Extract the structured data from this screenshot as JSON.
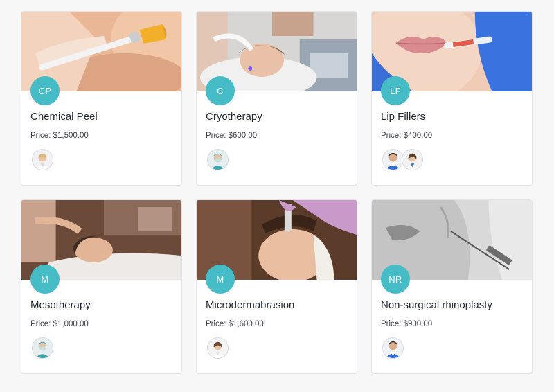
{
  "theme": {
    "accent": "#46bcc6"
  },
  "treatments": [
    {
      "initials": "CP",
      "name": "Chemical Peel",
      "price": "Price: $1,500.00",
      "image": "brush-applying-peel-to-face-photo",
      "staff": [
        {
          "avatar": "female-doctor-avatar"
        }
      ]
    },
    {
      "initials": "C",
      "name": "Cryotherapy",
      "price": "Price: $600.00",
      "image": "facial-cryo-device-treatment-photo",
      "staff": [
        {
          "avatar": "masked-practitioner-avatar"
        }
      ]
    },
    {
      "initials": "LF",
      "name": "Lip Fillers",
      "price": "Price: $400.00",
      "image": "lip-injection-syringe-photo",
      "staff": [
        {
          "avatar": "male-doctor-avatar"
        },
        {
          "avatar": "female-doctor-avatar"
        }
      ]
    },
    {
      "initials": "M",
      "name": "Mesotherapy",
      "price": "Price: $1,000.00",
      "image": "woman-receiving-facial-treatment-photo",
      "staff": [
        {
          "avatar": "masked-practitioner-avatar"
        }
      ]
    },
    {
      "initials": "M",
      "name": "Microdermabrasion",
      "price": "Price: $1,600.00",
      "image": "microdermabrasion-facial-photo",
      "staff": [
        {
          "avatar": "female-doctor-avatar"
        }
      ]
    },
    {
      "initials": "NR",
      "name": "Non-surgical rhinoplasty",
      "price": "Price: $900.00",
      "image": "nose-injection-monochrome-photo",
      "staff": [
        {
          "avatar": "male-doctor-avatar"
        }
      ]
    }
  ]
}
